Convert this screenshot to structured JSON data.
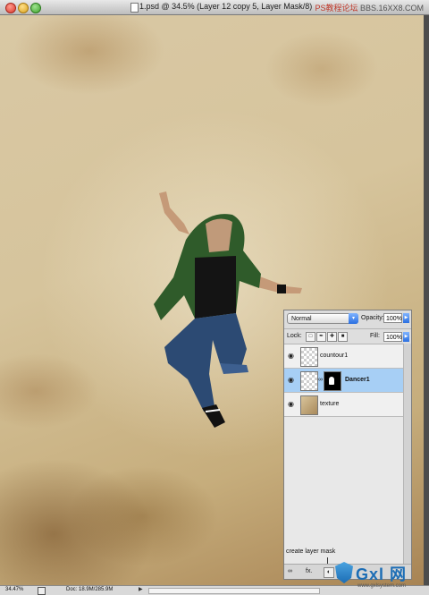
{
  "window": {
    "title": "1.psd @ 34.5% (Layer 12 copy 5, Layer Mask/8)",
    "watermark_prefix": "PS教程论坛",
    "watermark_domain": "BBS.16XX8.COM"
  },
  "layers_panel": {
    "blend_mode": "Normal",
    "opacity_label": "Opacity:",
    "opacity_value": "100%",
    "lock_label": "Lock:",
    "fill_label": "Fill:",
    "fill_value": "100%",
    "layers": [
      {
        "name": "countour1",
        "selected": false,
        "thumb": "transparent"
      },
      {
        "name": "Dancer1",
        "selected": true,
        "thumb": "transparent",
        "has_mask": true
      },
      {
        "name": "texture",
        "selected": false,
        "thumb": "texture"
      }
    ],
    "tooltip": "create layer mask",
    "bottom_fx": "fx."
  },
  "status_bar": {
    "zoom": "34.47%",
    "doc_info": "Doc: 18.9M/285.9M"
  },
  "watermark": {
    "logo_text": "Gxl 网",
    "url": "www.gxlsystem.com"
  },
  "icons": [
    "close-button",
    "minimize-button",
    "zoom-button",
    "eye-icon",
    "chain-link-icon",
    "lock-icon",
    "move-icon",
    "brush-icon",
    "link-icon",
    "fx-icon",
    "mask-icon"
  ]
}
